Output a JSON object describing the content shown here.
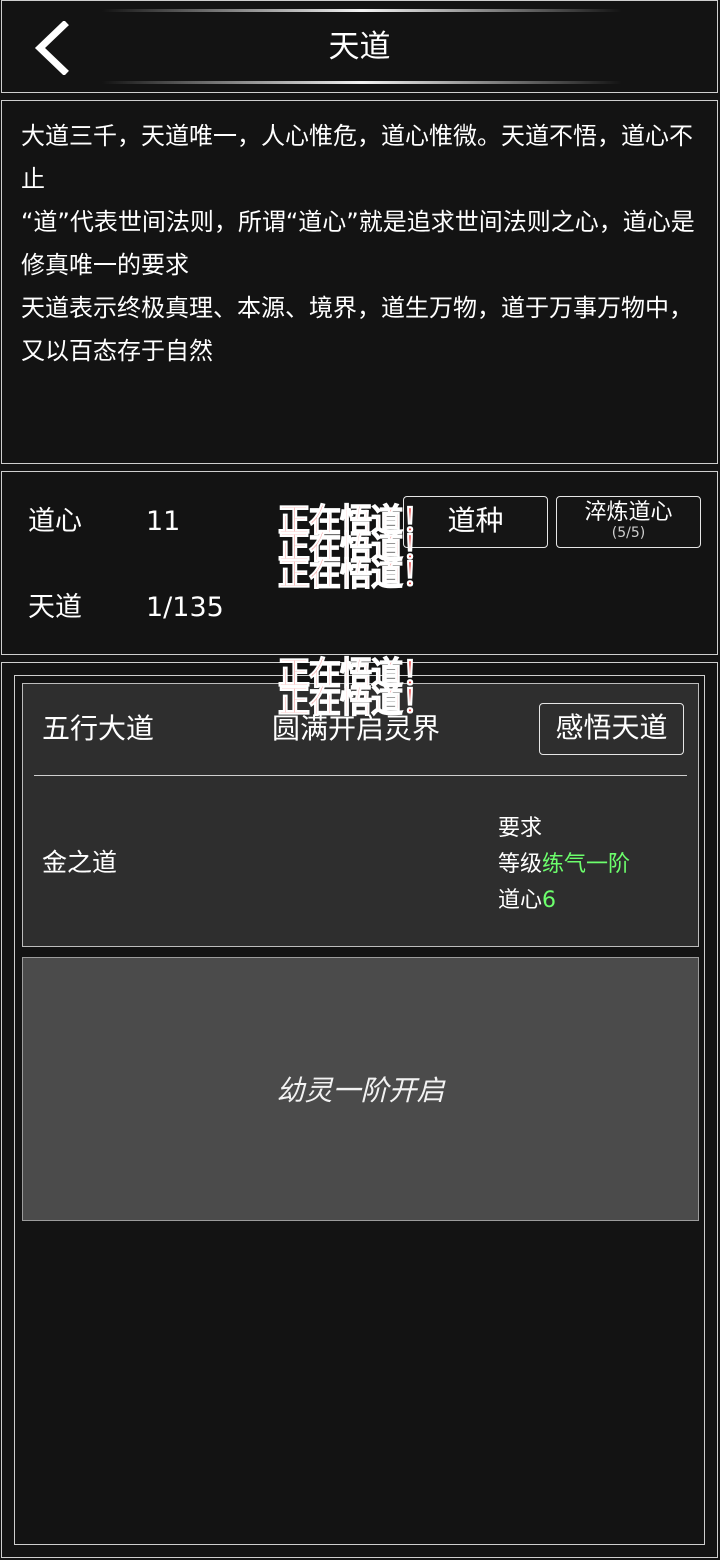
{
  "header": {
    "title": "天道",
    "back_icon": "chevron-left-icon"
  },
  "description": {
    "lines": [
      "大道三千，天道唯一，人心惟危，道心惟微。天道不悟，道心不止",
      "“道”代表世间法则，所谓“道心”就是追求世间法则之心，道心是修真唯一的要求",
      "天道表示终极真理、本源、境界，道生万物，道于万事万物中，又以百态存于自然"
    ]
  },
  "stats": {
    "daoxin_label": "道心",
    "daoxin_value": "11",
    "tiandao_label": "天道",
    "tiandao_value": "1/135"
  },
  "buttons": {
    "daozhong": "道种",
    "cuilian": "淬炼道心",
    "cuilian_sub": "(5/5)",
    "ganwu": "感悟天道"
  },
  "floating_text": "正在悟道！",
  "card": {
    "title": "五行大道",
    "goal": "圆满开启灵界",
    "sub_name": "金之道",
    "req_title": "要求",
    "req_level_label": "等级",
    "req_level_value": "练气一阶",
    "req_daoxin_label": "道心",
    "req_daoxin_value": "6"
  },
  "locked_card": {
    "text": "幼灵一阶开启"
  },
  "colors": {
    "background": "#141414",
    "highlight_green": "#6cff6c",
    "floating_red": "#e60f0f"
  }
}
